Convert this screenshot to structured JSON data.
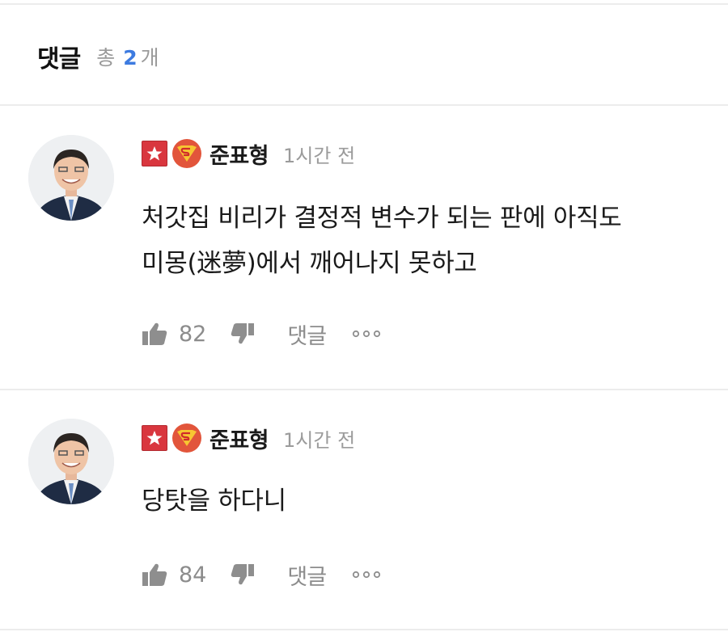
{
  "header": {
    "title": "댓글",
    "total_prefix": "총",
    "total_count": "2",
    "total_suffix": "개"
  },
  "colors": {
    "accent": "#3d7be0",
    "badge_red": "#d9363e",
    "badge_orange": "#e2553b",
    "meta_gray": "#9b9b9b"
  },
  "icons": [
    "star-badge-icon",
    "superman-badge-icon",
    "thumbs-up-icon",
    "thumbs-down-icon",
    "more-icon"
  ],
  "comments": [
    {
      "author": "준표형",
      "time": "1시간 전",
      "body": "처갓집 비리가 결정적 변수가 되는 판에 아직도\n미몽(迷夢)에서 깨어나지 못하고",
      "likes": "82",
      "reply_label": "댓글"
    },
    {
      "author": "준표형",
      "time": "1시간 전",
      "body": "당탓을 하다니",
      "likes": "84",
      "reply_label": "댓글"
    }
  ]
}
